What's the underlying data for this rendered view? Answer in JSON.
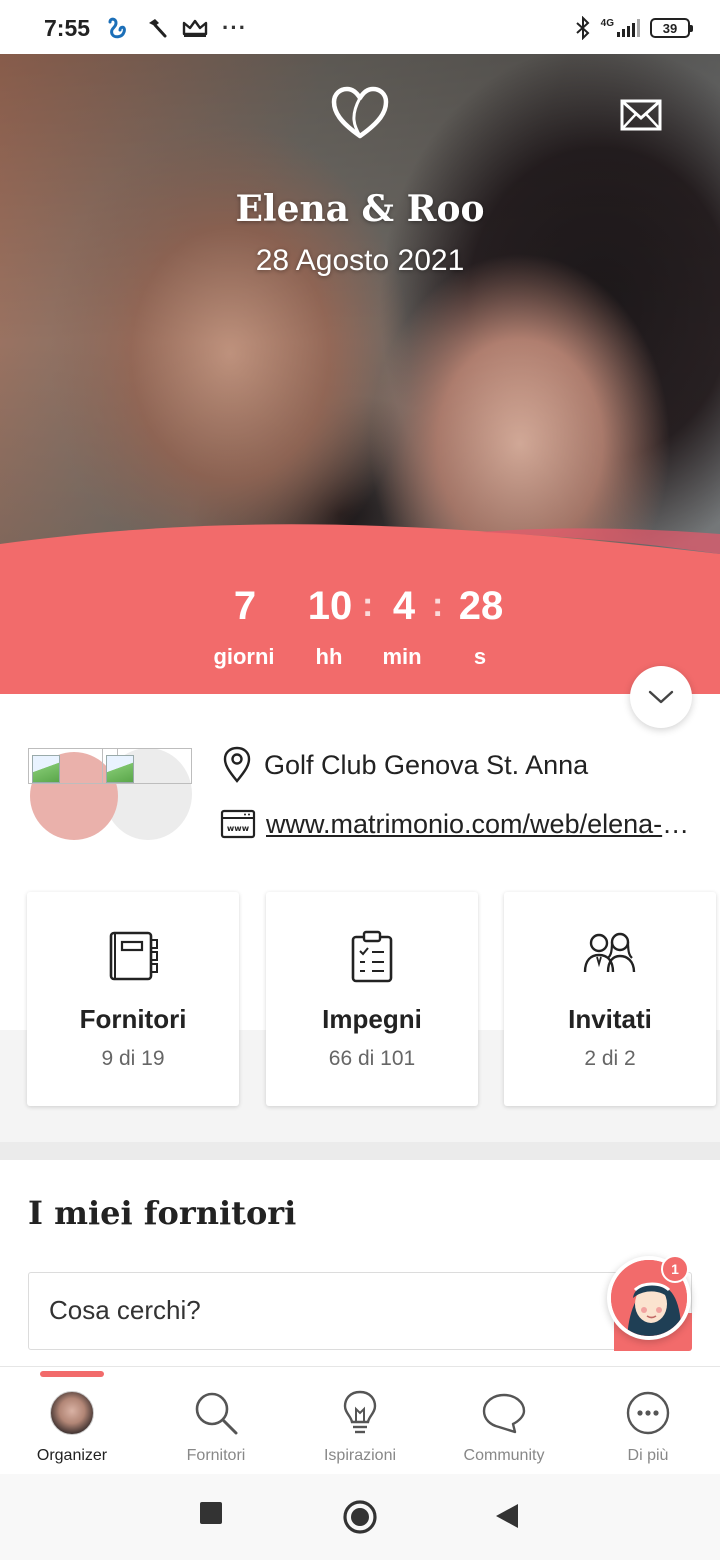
{
  "status_bar": {
    "time": "7:55",
    "more": "···",
    "network": "4G",
    "battery": "39"
  },
  "hero": {
    "couple_name": "Elena & Roo",
    "date": "28 Agosto 2021"
  },
  "countdown": {
    "days": "7",
    "hours": "10",
    "minutes": "4",
    "seconds": "28",
    "separator": ":",
    "days_label": "giorni",
    "hours_label": "hh",
    "minutes_label": "min",
    "seconds_label": "s"
  },
  "info": {
    "location": "Golf Club Genova St. Anna",
    "website": "www.matrimonio.com/web/elena-e-roo"
  },
  "cards": [
    {
      "title": "Fornitori",
      "count": "9 di 19"
    },
    {
      "title": "Impegni",
      "count": "66 di 101"
    },
    {
      "title": "Invitati",
      "count": "2 di 2"
    }
  ],
  "vendors": {
    "title": "I miei fornitori",
    "search_placeholder": "Cosa cerchi?",
    "chat_badge": "1"
  },
  "bottom_nav": [
    {
      "label": "Organizer",
      "active": true
    },
    {
      "label": "Fornitori"
    },
    {
      "label": "Ispirazioni"
    },
    {
      "label": "Community"
    },
    {
      "label": "Di più"
    }
  ],
  "colors": {
    "accent": "#f26b6b",
    "text": "#222222",
    "muted": "#888888"
  }
}
